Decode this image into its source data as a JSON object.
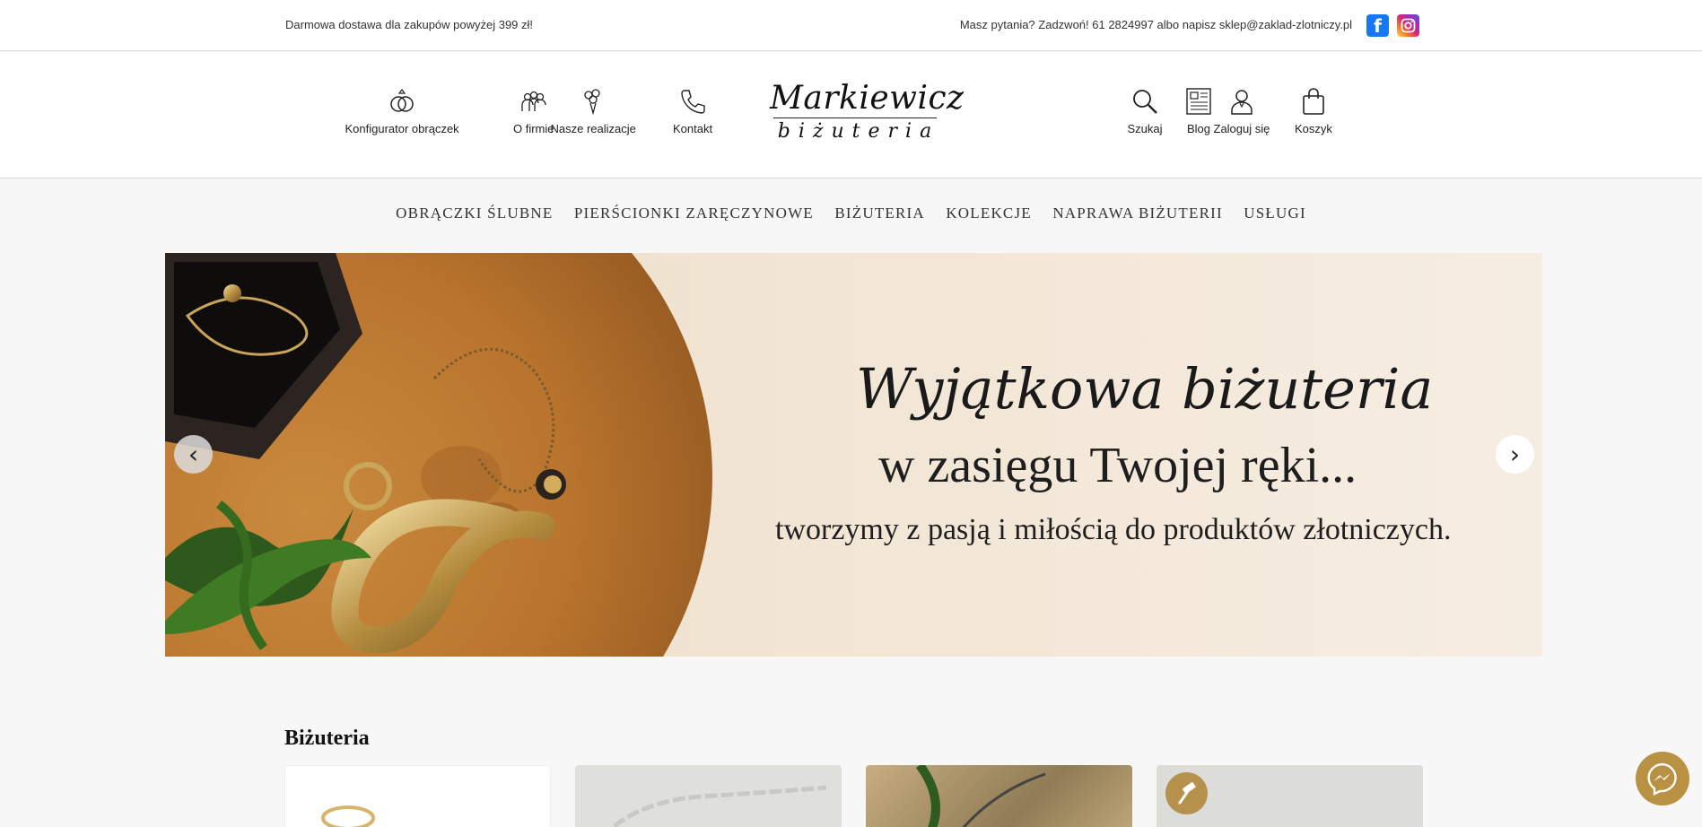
{
  "topbar": {
    "promo": "Darmowa dostawa dla zakupów powyżej 399 zł!",
    "contact": "Masz pytania? Zadzwoń! 61 2824997 albo napisz sklep@zaklad-zlotniczy.pl",
    "facebook_glyph": "f"
  },
  "header": {
    "left_nav": [
      {
        "label": "Konfigurator obrączek",
        "icon": "rings-icon"
      },
      {
        "label": "O firmie",
        "icon": "people-icon"
      },
      {
        "label": "Nasze realizacje",
        "icon": "bouquet-icon"
      },
      {
        "label": "Kontakt",
        "icon": "phone-icon"
      }
    ],
    "logo": {
      "main": "Markiewicz",
      "sub": "biżuteria"
    },
    "right_nav": [
      {
        "label": "Szukaj",
        "icon": "search-icon"
      },
      {
        "label": "Blog",
        "icon": "newspaper-icon"
      },
      {
        "label": "Zaloguj się",
        "icon": "user-icon"
      },
      {
        "label": "Koszyk",
        "icon": "shopping-bag-icon"
      }
    ]
  },
  "main_menu": [
    "OBRĄCZKI ŚLUBNE",
    "PIERŚCIONKI ZARĘCZYNOWE",
    "BIŻUTERIA",
    "KOLEKCJE",
    "NAPRAWA BIŻUTERII",
    "USŁUGI"
  ],
  "banner": {
    "headline": "Wyjątkowa biżuteria",
    "subhead": "w zasięgu Twojej ręki...",
    "tagline": "tworzymy z pasją i miłością do produktów złotniczych.",
    "prev_glyph": "‹",
    "next_glyph": "›"
  },
  "section": {
    "title": "Biżuteria"
  },
  "colors": {
    "accent": "#b89142",
    "facebook": "#1877f2"
  }
}
